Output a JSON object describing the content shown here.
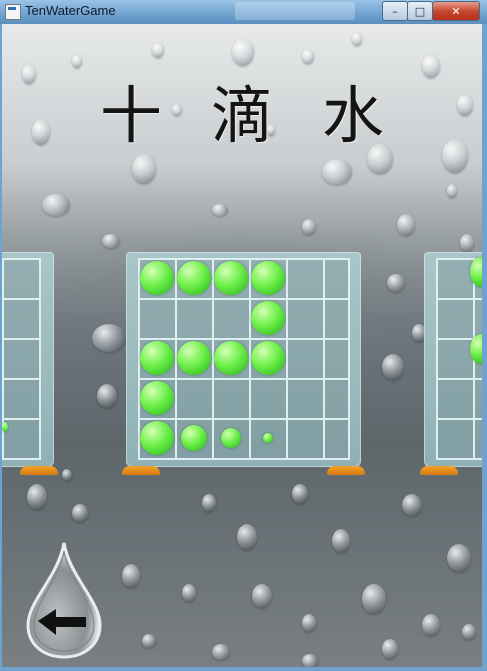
{
  "window": {
    "title": "TenWaterGame",
    "controls": {
      "minimize": "–",
      "maximize": "□",
      "close": "✕"
    }
  },
  "game": {
    "title_glyphs": [
      "十",
      "滴",
      "水"
    ],
    "boards": [
      {
        "name": "left-board-partial",
        "active_cells": []
      },
      {
        "name": "level-board",
        "drop_color": "#6ef04a",
        "cells": [
          {
            "row": 0,
            "col": 0,
            "level": 4
          },
          {
            "row": 0,
            "col": 1,
            "level": 4
          },
          {
            "row": 0,
            "col": 2,
            "level": 4
          },
          {
            "row": 0,
            "col": 3,
            "level": 4
          },
          {
            "row": 1,
            "col": 3,
            "level": 4
          },
          {
            "row": 2,
            "col": 0,
            "level": 4
          },
          {
            "row": 2,
            "col": 1,
            "level": 4
          },
          {
            "row": 2,
            "col": 2,
            "level": 4
          },
          {
            "row": 2,
            "col": 3,
            "level": 4
          },
          {
            "row": 3,
            "col": 0,
            "level": 4
          },
          {
            "row": 4,
            "col": 0,
            "level": 4
          },
          {
            "row": 4,
            "col": 1,
            "level": 3
          },
          {
            "row": 4,
            "col": 2,
            "level": 2
          },
          {
            "row": 4,
            "col": 3,
            "level": 1
          }
        ]
      },
      {
        "name": "right-board-partial",
        "active_cells": []
      }
    ],
    "back_icon": "back-arrow-droplet-icon"
  }
}
